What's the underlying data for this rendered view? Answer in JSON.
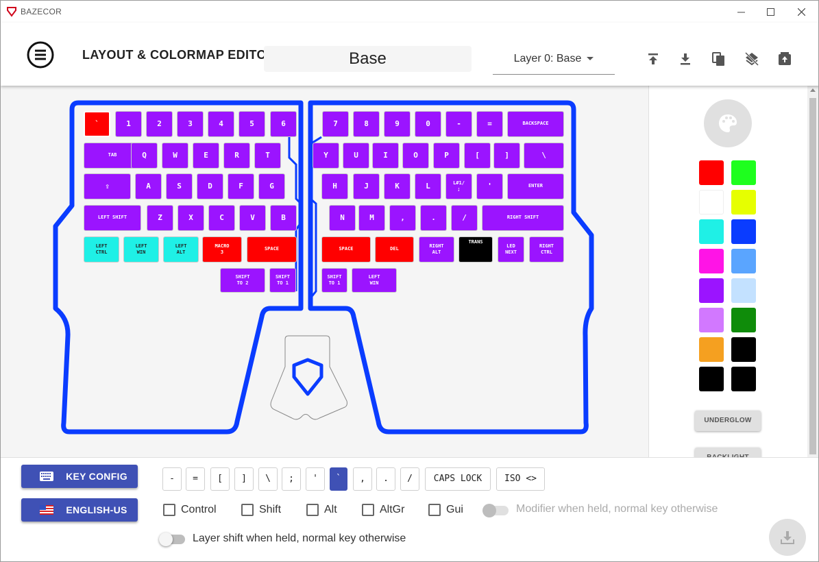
{
  "window": {
    "title": "BAZECOR"
  },
  "header": {
    "page_title": "LAYOUT & COLORMAP EDITOR",
    "layer_name": "Base",
    "layer_select": "Layer 0: Base"
  },
  "keyboard": {
    "keys": [
      {
        "label": "`",
        "color": "#ff0000",
        "selected": true
      },
      {
        "label": "1",
        "color": "#9b14ff"
      },
      {
        "label": "2",
        "color": "#9b14ff"
      },
      {
        "label": "3",
        "color": "#9b14ff"
      },
      {
        "label": "4",
        "color": "#9b14ff"
      },
      {
        "label": "5",
        "color": "#9b14ff"
      },
      {
        "label": "6",
        "color": "#9b14ff"
      },
      {
        "label": "7",
        "color": "#9b14ff"
      },
      {
        "label": "8",
        "color": "#9b14ff"
      },
      {
        "label": "9",
        "color": "#9b14ff"
      },
      {
        "label": "0",
        "color": "#9b14ff"
      },
      {
        "label": "-",
        "color": "#9b14ff"
      },
      {
        "label": "=",
        "color": "#9b14ff"
      },
      {
        "label": "BACKSPACE",
        "color": "#9b14ff"
      },
      {
        "label": "TAB",
        "color": "#9b14ff"
      },
      {
        "label": "Q",
        "color": "#9b14ff"
      },
      {
        "label": "W",
        "color": "#9b14ff"
      },
      {
        "label": "E",
        "color": "#9b14ff"
      },
      {
        "label": "R",
        "color": "#9b14ff"
      },
      {
        "label": "T",
        "color": "#9b14ff"
      },
      {
        "label": "Y",
        "color": "#9b14ff"
      },
      {
        "label": "U",
        "color": "#9b14ff"
      },
      {
        "label": "I",
        "color": "#9b14ff"
      },
      {
        "label": "O",
        "color": "#9b14ff"
      },
      {
        "label": "P",
        "color": "#9b14ff"
      },
      {
        "label": "[",
        "color": "#9b14ff"
      },
      {
        "label": "]",
        "color": "#9b14ff"
      },
      {
        "label": "\\",
        "color": "#9b14ff"
      },
      {
        "label": "⇪",
        "color": "#9b14ff"
      },
      {
        "label": "A",
        "color": "#9b14ff"
      },
      {
        "label": "S",
        "color": "#9b14ff"
      },
      {
        "label": "D",
        "color": "#9b14ff"
      },
      {
        "label": "F",
        "color": "#9b14ff"
      },
      {
        "label": "G",
        "color": "#9b14ff"
      },
      {
        "label": "H",
        "color": "#9b14ff"
      },
      {
        "label": "J",
        "color": "#9b14ff"
      },
      {
        "label": "K",
        "color": "#9b14ff"
      },
      {
        "label": "L",
        "color": "#9b14ff"
      },
      {
        "label": "L#1/\n;",
        "color": "#9b14ff"
      },
      {
        "label": "'",
        "color": "#9b14ff"
      },
      {
        "label": "ENTER",
        "color": "#9b14ff"
      },
      {
        "label": "LEFT SHIFT",
        "color": "#9b14ff"
      },
      {
        "label": "Z",
        "color": "#9b14ff"
      },
      {
        "label": "X",
        "color": "#9b14ff"
      },
      {
        "label": "C",
        "color": "#9b14ff"
      },
      {
        "label": "V",
        "color": "#9b14ff"
      },
      {
        "label": "B",
        "color": "#9b14ff"
      },
      {
        "label": "N",
        "color": "#9b14ff"
      },
      {
        "label": "M",
        "color": "#9b14ff"
      },
      {
        "label": ",",
        "color": "#9b14ff"
      },
      {
        "label": ".",
        "color": "#9b14ff"
      },
      {
        "label": "/",
        "color": "#9b14ff"
      },
      {
        "label": "RIGHT SHIFT",
        "color": "#9b14ff"
      },
      {
        "label": "LEFT\nCTRL",
        "color": "#1ff0e6"
      },
      {
        "label": "LEFT\nWIN",
        "color": "#1ff0e6"
      },
      {
        "label": "LEFT\nALT",
        "color": "#1ff0e6"
      },
      {
        "label": "MACRO\n3",
        "color": "#ff0000"
      },
      {
        "label": "SPACE",
        "color": "#ff0000"
      },
      {
        "label": "SPACE",
        "color": "#ff0000"
      },
      {
        "label": "DEL",
        "color": "#ff0000"
      },
      {
        "label": "RIGHT\nALT",
        "color": "#9b14ff"
      },
      {
        "label": "TRANS",
        "color": "#000000"
      },
      {
        "label": "LED\nNEXT",
        "color": "#9b14ff"
      },
      {
        "label": "RIGHT\nCTRL",
        "color": "#9b14ff"
      },
      {
        "label": "SHIFT\nTO 2",
        "color": "#9b14ff"
      },
      {
        "label": "SHIFT\nTO 1",
        "color": "#9b14ff"
      },
      {
        "label": "SHIFT\nTO 1",
        "color": "#9b14ff"
      },
      {
        "label": "LEFT\nWIN",
        "color": "#9b14ff"
      }
    ]
  },
  "palette": {
    "swatches": [
      "#ff0000",
      "#1eff1e",
      "#ffffff",
      "#e6ff00",
      "#1ff0e6",
      "#0a3cff",
      "#ff14e6",
      "#5aa5ff",
      "#9b14ff",
      "#c3e1ff",
      "#d278ff",
      "#0f8c0a",
      "#f5a020",
      "#000000",
      "#000000",
      "#000000"
    ],
    "underglow_label": "UNDERGLOW",
    "backlight_label": "BACKLIGHT"
  },
  "bottom": {
    "key_config_label": "KEY CONFIG",
    "language_label": "ENGLISH-US",
    "chips": [
      {
        "label": "-",
        "selected": false
      },
      {
        "label": "=",
        "selected": false
      },
      {
        "label": "[",
        "selected": false
      },
      {
        "label": "]",
        "selected": false
      },
      {
        "label": "\\",
        "selected": false
      },
      {
        "label": ";",
        "selected": false
      },
      {
        "label": "'",
        "selected": false
      },
      {
        "label": "`",
        "selected": true
      },
      {
        "label": ",",
        "selected": false
      },
      {
        "label": ".",
        "selected": false
      },
      {
        "label": "/",
        "selected": false
      },
      {
        "label": "CAPS LOCK",
        "selected": false
      },
      {
        "label": "ISO <>",
        "selected": false
      }
    ],
    "modifiers": [
      "Control",
      "Shift",
      "Alt",
      "AltGr",
      "Gui"
    ],
    "modifier_toggle_label": "Modifier when held, normal key otherwise",
    "layer_toggle_label": "Layer shift when held, normal key otherwise"
  }
}
